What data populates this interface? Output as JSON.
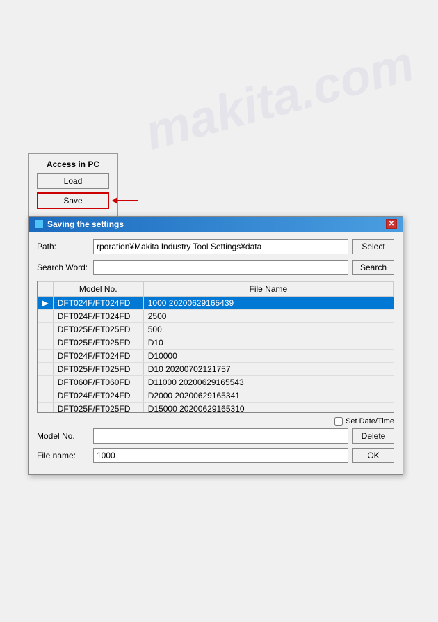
{
  "watermark": {
    "text": "makita.com"
  },
  "access_panel": {
    "title": "Access in PC",
    "load_label": "Load",
    "save_label": "Save"
  },
  "dialog": {
    "title": "Saving the settings",
    "path_label": "Path:",
    "path_value": "rporation¥Makita Industry Tool Settings¥data",
    "select_label": "Select",
    "search_word_label": "Search Word:",
    "search_word_value": "",
    "search_label": "Search",
    "table": {
      "col_arrow": "",
      "col_model": "Model No.",
      "col_filename": "File Name",
      "rows": [
        {
          "arrow": "▶",
          "model": "DFT024F/FT024FD",
          "filename": "1000 20200629165439",
          "selected": true
        },
        {
          "arrow": "",
          "model": "DFT024F/FT024FD",
          "filename": "2500",
          "selected": false
        },
        {
          "arrow": "",
          "model": "DFT025F/FT025FD",
          "filename": "500",
          "selected": false
        },
        {
          "arrow": "",
          "model": "DFT025F/FT025FD",
          "filename": "D10",
          "selected": false
        },
        {
          "arrow": "",
          "model": "DFT024F/FT024FD",
          "filename": "D10000",
          "selected": false
        },
        {
          "arrow": "",
          "model": "DFT025F/FT025FD",
          "filename": "D10 20200702121757",
          "selected": false
        },
        {
          "arrow": "",
          "model": "DFT060F/FT060FD",
          "filename": "D11000 20200629165543",
          "selected": false
        },
        {
          "arrow": "",
          "model": "DFT024F/FT024FD",
          "filename": "D2000 20200629165341",
          "selected": false
        },
        {
          "arrow": "",
          "model": "DFT025F/FT025FD",
          "filename": "D15000 20200629165310",
          "selected": false
        }
      ]
    },
    "set_datetime_label": "Set Date/Time",
    "model_no_label": "Model No.",
    "model_no_value": "",
    "delete_label": "Delete",
    "file_name_label": "File name:",
    "file_name_value": "1000",
    "ok_label": "OK"
  }
}
